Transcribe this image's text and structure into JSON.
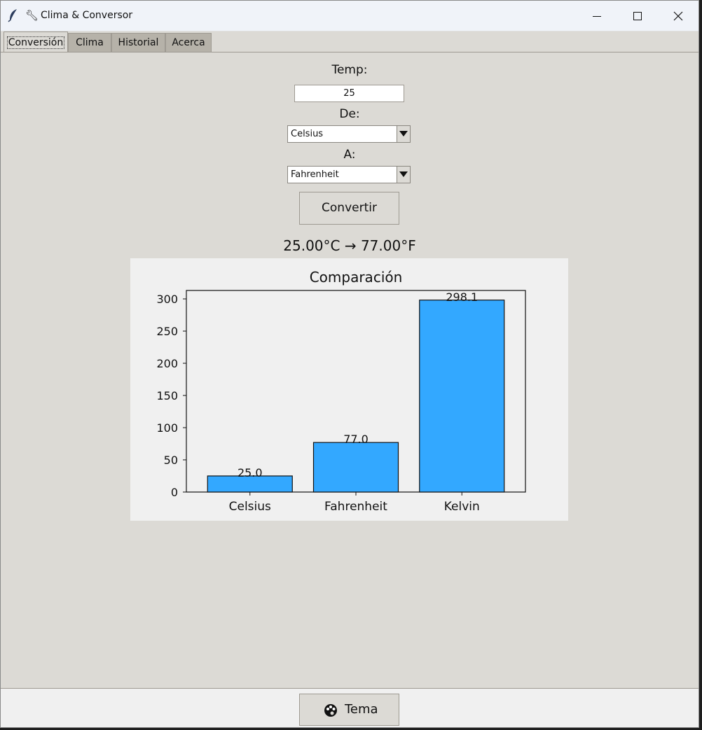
{
  "window": {
    "title": "Clima & Conversor",
    "title_icon": "wrench-icon",
    "app_icon": "feather-icon"
  },
  "tabs": [
    {
      "label": "Conversión",
      "active": true
    },
    {
      "label": "Clima",
      "active": false
    },
    {
      "label": "Historial",
      "active": false
    },
    {
      "label": "Acerca",
      "active": false
    }
  ],
  "form": {
    "temp_label": "Temp:",
    "temp_value": "25",
    "from_label": "De:",
    "from_value": "Celsius",
    "to_label": "A:",
    "to_value": "Fahrenheit",
    "convert_button": "Convertir"
  },
  "result": "25.00°C → 77.00°F",
  "chart_data": {
    "type": "bar",
    "title": "Comparación",
    "categories": [
      "Celsius",
      "Fahrenheit",
      "Kelvin"
    ],
    "values": [
      25.0,
      77.0,
      298.15
    ],
    "data_labels": [
      "25.0",
      "77.0",
      "298.1"
    ],
    "ylim": [
      0,
      313.1
    ],
    "yticks": [
      0,
      50,
      100,
      150,
      200,
      250,
      300
    ],
    "bar_color": "#33a8ff",
    "xlabel": "",
    "ylabel": ""
  },
  "footer": {
    "theme_button": "Tema",
    "theme_icon": "palette-icon"
  }
}
